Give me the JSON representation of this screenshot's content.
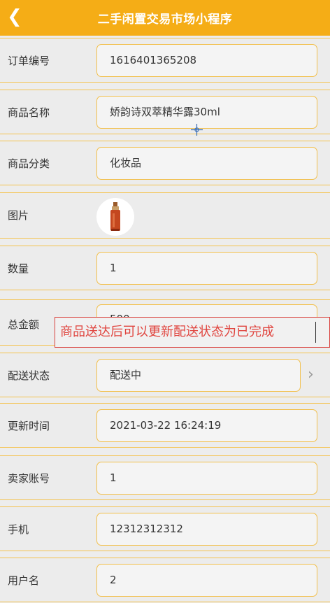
{
  "header": {
    "title": "二手闲置交易市场小程序",
    "back_icon": "chevron-left-icon"
  },
  "fields": [
    {
      "label": "订单编号",
      "value": "1616401365208"
    },
    {
      "label": "商品名称",
      "value": "娇韵诗双萃精华露30ml"
    },
    {
      "label": "商品分类",
      "value": "化妆品"
    },
    {
      "label": "图片",
      "value": ""
    },
    {
      "label": "数量",
      "value": "1"
    },
    {
      "label": "总金额",
      "value": "500"
    },
    {
      "label": "配送状态",
      "value": "配送中"
    },
    {
      "label": "更新时间",
      "value": "2021-03-22 16:24:19"
    },
    {
      "label": "卖家账号",
      "value": "1"
    },
    {
      "label": "手机",
      "value": "12312312312"
    },
    {
      "label": "用户名",
      "value": "2"
    }
  ],
  "annotation": {
    "text": "商品送达后可以更新配送状态为已完成"
  },
  "colors": {
    "header_bg": "#f5ad16",
    "field_border": "#f2bf4a",
    "annotation_red": "#e0443e"
  }
}
